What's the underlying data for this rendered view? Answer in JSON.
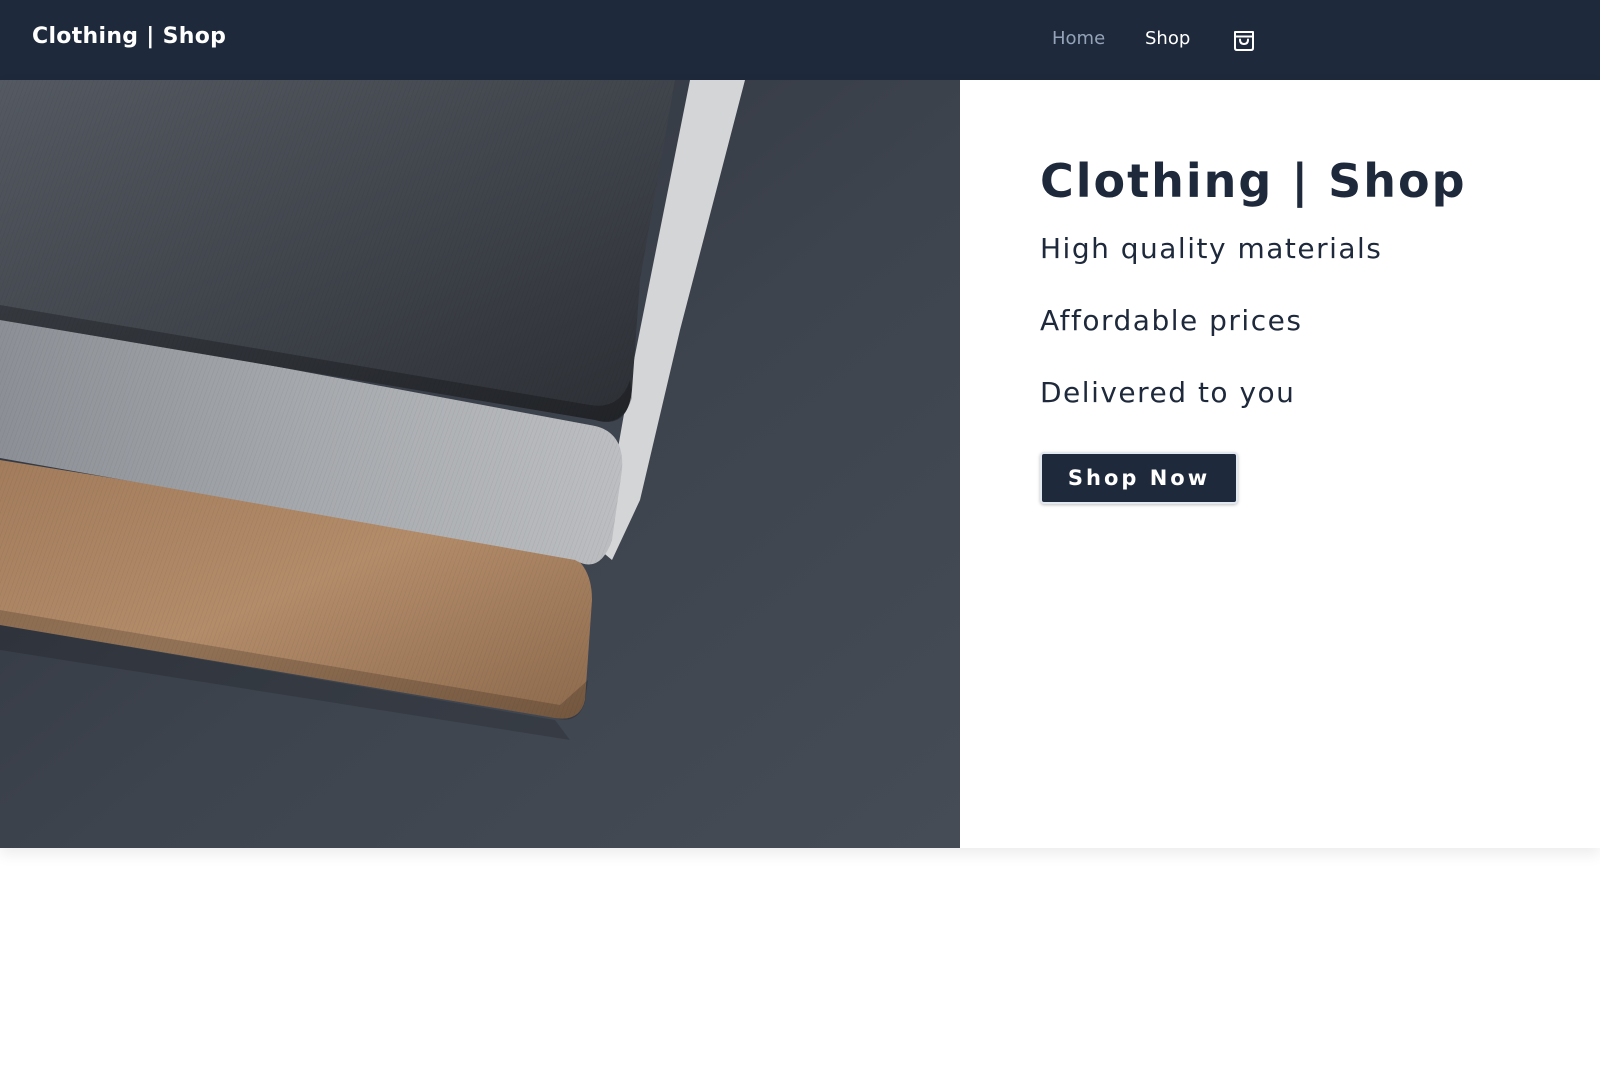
{
  "nav": {
    "brand": "Clothing | Shop",
    "links": [
      {
        "label": "Home",
        "state": "inactive"
      },
      {
        "label": "Shop",
        "state": "active"
      }
    ],
    "cart_icon": "shopping-bag-icon"
  },
  "hero": {
    "image": "folded-shirts-photo",
    "title": "Clothing | Shop",
    "features": [
      "High quality materials",
      "Affordable prices",
      "Delivered to you"
    ],
    "cta_label": "Shop Now"
  },
  "colors": {
    "navbar_bg": "#1e293b",
    "nav_inactive": "#94a3b8",
    "text_primary": "#1e293b",
    "button_bg": "#1e293b",
    "button_text": "#ffffff"
  }
}
